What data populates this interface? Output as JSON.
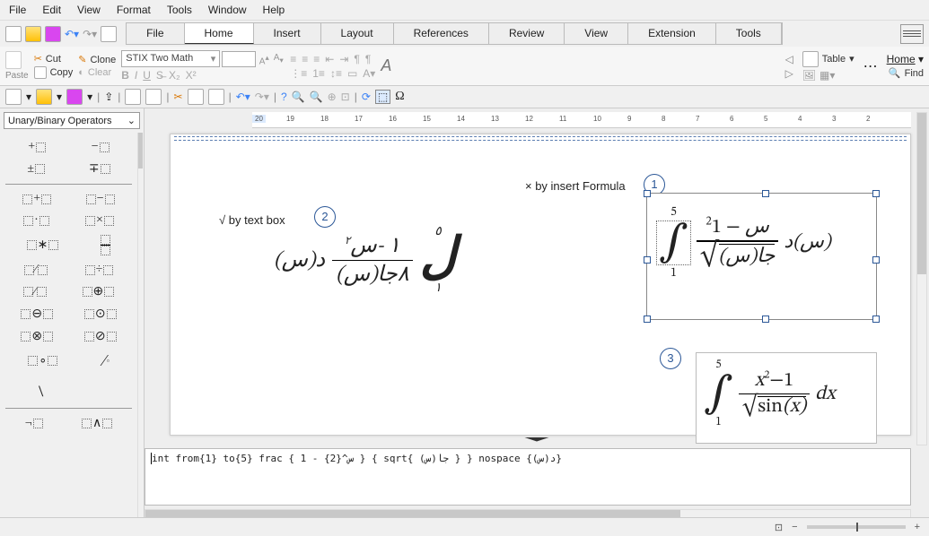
{
  "menubar": [
    "File",
    "Edit",
    "View",
    "Format",
    "Tools",
    "Window",
    "Help"
  ],
  "tabs": [
    "File",
    "Home",
    "Insert",
    "Layout",
    "References",
    "Review",
    "View",
    "Extension",
    "Tools"
  ],
  "active_tab": "Home",
  "ribbon": {
    "paste": "Paste",
    "cut": "Cut",
    "copy": "Copy",
    "clone": "Clone",
    "clear": "Clear",
    "font": "STIX Two Math",
    "home": "Home",
    "find": "Find",
    "table": "Table"
  },
  "sidepanel": {
    "dropdown": "Unary/Binary Operators"
  },
  "ruler_ticks": [
    "20",
    "19",
    "18",
    "17",
    "16",
    "15",
    "14",
    "13",
    "12",
    "11",
    "10",
    "9",
    "8",
    "7",
    "6",
    "5",
    "4",
    "3",
    "2"
  ],
  "page": {
    "label_formula": "× by insert Formula",
    "label_textbox": "√ by text box",
    "marker1": "1",
    "marker2": "2",
    "marker3": "3",
    "formula1": {
      "upper": "5",
      "lower": "1",
      "num_sup": "2",
      "num_rest": "س",
      "minus": "−",
      "one": "1",
      "sqrt_inner": "(س)جا",
      "d": "د",
      "dx_paren": "(س)"
    },
    "formula2": {
      "upper": "٥",
      "lower": "١",
      "num": "١ -س",
      "num_sup": "٢",
      "den": "جا(س)",
      "den_pre": "٨",
      "d": "د(س)",
      "intglyph": "ل"
    },
    "formula3": {
      "upper": "5",
      "lower": "1",
      "x": "x",
      "sup": "2",
      "minus": "−",
      "one": "1",
      "sin": "sin",
      "xp": "x",
      "dx": "dx"
    }
  },
  "command": "int from{1} to{5} frac { 1 - {2}^س } { sqrt{ (جا(س } }   nospace {(د(س}"
}
